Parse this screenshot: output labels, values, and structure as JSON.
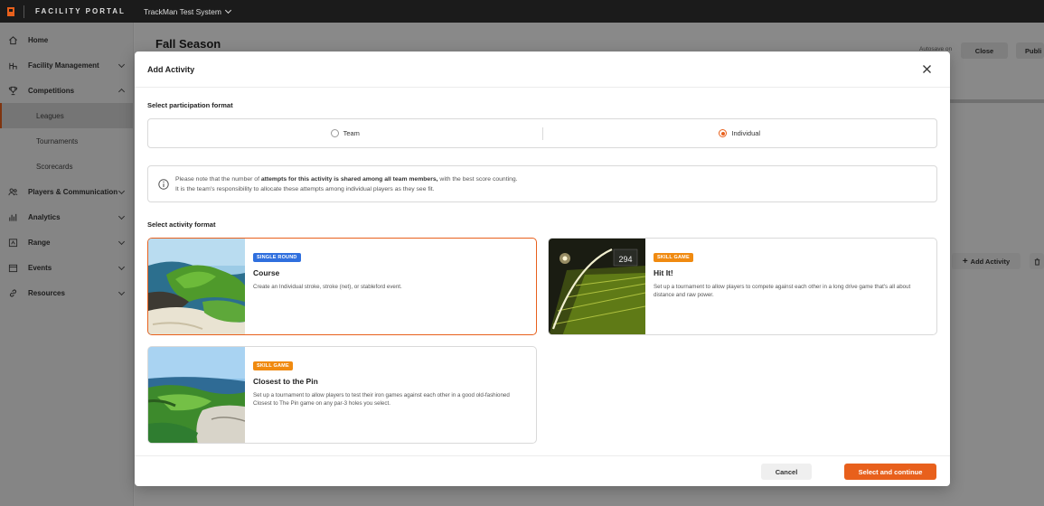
{
  "topbar": {
    "portal": "FACILITY PORTAL",
    "system": "TrackMan Test System"
  },
  "sidebar": {
    "items": [
      {
        "label": "Home",
        "icon": "home-icon"
      },
      {
        "label": "Facility Management",
        "icon": "facility-icon"
      },
      {
        "label": "Competitions",
        "icon": "trophy-icon"
      },
      {
        "label": "Players & Communication",
        "icon": "players-icon"
      },
      {
        "label": "Analytics",
        "icon": "analytics-icon"
      },
      {
        "label": "Range",
        "icon": "range-icon"
      },
      {
        "label": "Events",
        "icon": "calendar-icon"
      },
      {
        "label": "Resources",
        "icon": "link-icon"
      }
    ],
    "sub_items": [
      "Leagues",
      "Tournaments",
      "Scorecards"
    ],
    "active_sub": "Leagues"
  },
  "background": {
    "page_title": "Fall Season",
    "autosave": "Autosave on",
    "close": "Close",
    "publish": "Publi",
    "add_activity": "Add Activity"
  },
  "modal": {
    "title": "Add Activity",
    "participation_label": "Select participation format",
    "options": [
      {
        "label": "Team",
        "selected": false
      },
      {
        "label": "Individual",
        "selected": true
      }
    ],
    "notice": {
      "line1_pre": "Please note that the number of ",
      "line1_bold": "attempts for this activity is shared among all team members,",
      "line1_post": " with the best score counting.",
      "line2": "It is the team's responsibility to allocate these attempts among individual players as they see fit."
    },
    "activity_label": "Select activity format",
    "cards": [
      {
        "badge": "SINGLE ROUND",
        "title": "Course",
        "desc": "Create an Individual stroke, stroke (net), or stableford event.",
        "selected": true
      },
      {
        "badge": "SKILL GAME",
        "title": "Hit It!",
        "desc": "Set up a tournament to allow players to compete against each other in a long drive game that's all about distance and raw power.",
        "selected": false,
        "image_text": "294"
      },
      {
        "badge": "SKILL GAME",
        "title": "Closest to the Pin",
        "desc": "Set up a tournament to allow players to test their iron games against each other in a good old-fashioned Closest to The Pin game on any par-3 holes you select.",
        "selected": false
      }
    ],
    "cancel": "Cancel",
    "primary": "Select and continue"
  },
  "colors": {
    "accent": "#e8601c",
    "badge_blue": "#2f6fde",
    "badge_orange": "#f08a10",
    "topbar": "#1b1b1b"
  }
}
